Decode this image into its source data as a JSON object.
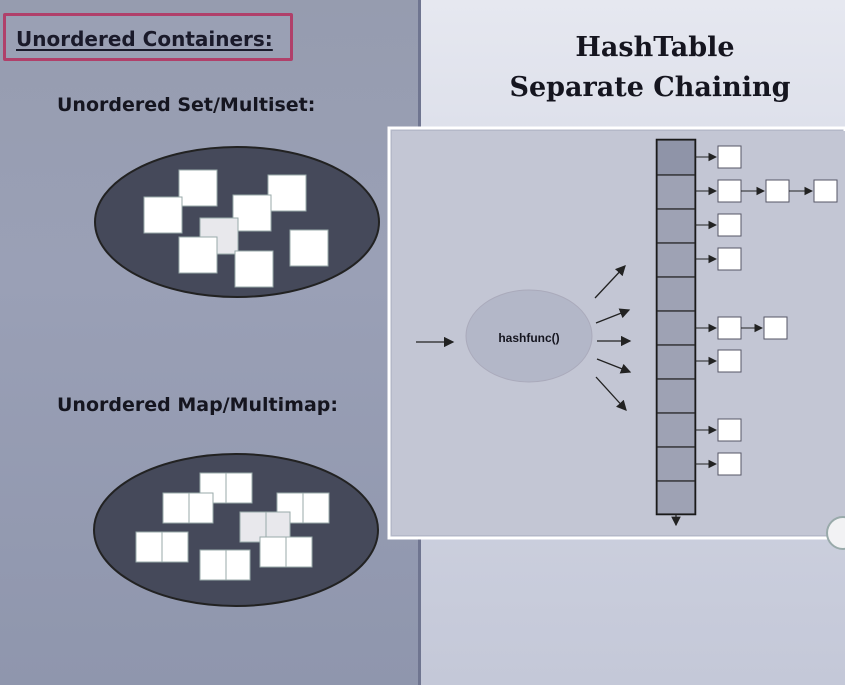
{
  "slide_left": {
    "title": "Unordered Containers:",
    "set_label": "Unordered Set/Multiset:",
    "map_label": "Unordered Map/Multimap:"
  },
  "slide_right": {
    "title_line1": "HashTable",
    "title_line2": "Separate Chaining",
    "hash_function_label": "hashfunc()"
  },
  "colors": {
    "left_bg": "#969caf",
    "ellipse_fill": "#45495a",
    "accent_border": "#b0406a",
    "hash_oval": "#b3b7c8"
  },
  "diagram": {
    "bucket_count": 11,
    "chains": [
      {
        "bucket": 0,
        "nodes": 1
      },
      {
        "bucket": 1,
        "nodes": 3
      },
      {
        "bucket": 2,
        "nodes": 1
      },
      {
        "bucket": 3,
        "nodes": 1
      },
      {
        "bucket": 5,
        "nodes": 2
      },
      {
        "bucket": 6,
        "nodes": 1
      },
      {
        "bucket": 8,
        "nodes": 1
      },
      {
        "bucket": 9,
        "nodes": 1
      }
    ]
  }
}
